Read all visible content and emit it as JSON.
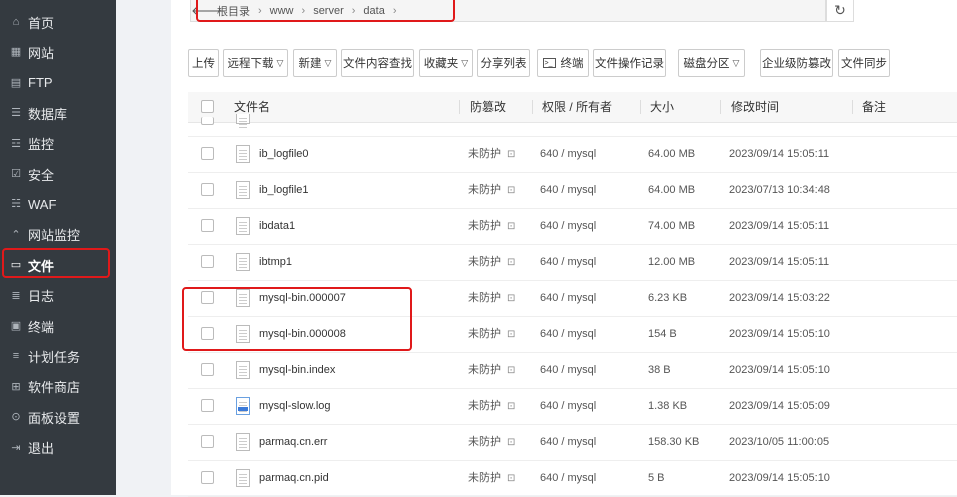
{
  "sidebar": {
    "items": [
      {
        "label": "首页",
        "icon": "home-icon",
        "glyph": "⌂"
      },
      {
        "label": "网站",
        "icon": "grid-icon",
        "glyph": "▦"
      },
      {
        "label": "FTP",
        "icon": "ftp-icon",
        "glyph": "▤"
      },
      {
        "label": "数据库",
        "icon": "database-icon",
        "glyph": "☰"
      },
      {
        "label": "监控",
        "icon": "monitor-icon",
        "glyph": "☲"
      },
      {
        "label": "安全",
        "icon": "shield-icon",
        "glyph": "☑"
      },
      {
        "label": "WAF",
        "icon": "waf-icon",
        "glyph": "☵"
      },
      {
        "label": "网站监控",
        "icon": "chart-icon",
        "glyph": "⌃"
      },
      {
        "label": "文件",
        "icon": "folder-icon",
        "glyph": "▭"
      },
      {
        "label": "日志",
        "icon": "log-icon",
        "glyph": "≣"
      },
      {
        "label": "终端",
        "icon": "terminal-icon",
        "glyph": "▣"
      },
      {
        "label": "计划任务",
        "icon": "task-icon",
        "glyph": "≡"
      },
      {
        "label": "软件商店",
        "icon": "store-icon",
        "glyph": "⊞"
      },
      {
        "label": "面板设置",
        "icon": "settings-icon",
        "glyph": "⊙"
      },
      {
        "label": "退出",
        "icon": "logout-icon",
        "glyph": "⇥"
      }
    ]
  },
  "path": {
    "back_icon": "arrow-left-icon",
    "crumbs": [
      "根目录",
      "www",
      "server",
      "data"
    ],
    "sep": "›",
    "refresh_icon": "refresh-icon"
  },
  "toolbar": {
    "upload": "上传",
    "remote_download": "远程下载",
    "new": "新建",
    "content_search": "文件内容查找",
    "favorites": "收藏夹",
    "share_list": "分享列表",
    "terminal": "终端",
    "file_ops_log": "文件操作记录",
    "disk_partition": "磁盘分区",
    "tamper_enterprise": "企业级防篡改",
    "file_sync": "文件同步"
  },
  "table": {
    "headers": {
      "name": "文件名",
      "tamper": "防篡改",
      "perm": "权限 / 所有者",
      "size": "大小",
      "mtime": "修改时间",
      "note": "备注"
    },
    "rows": [
      {
        "name": "ib_logfile0",
        "tamper": "未防护",
        "perm": "640 / mysql",
        "size": "64.00 MB",
        "mtime": "2023/09/14 15:05:11",
        "icon": "file"
      },
      {
        "name": "ib_logfile1",
        "tamper": "未防护",
        "perm": "640 / mysql",
        "size": "64.00 MB",
        "mtime": "2023/07/13 10:34:48",
        "icon": "file"
      },
      {
        "name": "ibdata1",
        "tamper": "未防护",
        "perm": "640 / mysql",
        "size": "74.00 MB",
        "mtime": "2023/09/14 15:05:11",
        "icon": "file"
      },
      {
        "name": "ibtmp1",
        "tamper": "未防护",
        "perm": "640 / mysql",
        "size": "12.00 MB",
        "mtime": "2023/09/14 15:05:11",
        "icon": "file"
      },
      {
        "name": "mysql-bin.000007",
        "tamper": "未防护",
        "perm": "640 / mysql",
        "size": "6.23 KB",
        "mtime": "2023/09/14 15:03:22",
        "icon": "file"
      },
      {
        "name": "mysql-bin.000008",
        "tamper": "未防护",
        "perm": "640 / mysql",
        "size": "154 B",
        "mtime": "2023/09/14 15:05:10",
        "icon": "file"
      },
      {
        "name": "mysql-bin.index",
        "tamper": "未防护",
        "perm": "640 / mysql",
        "size": "38 B",
        "mtime": "2023/09/14 15:05:10",
        "icon": "file"
      },
      {
        "name": "mysql-slow.log",
        "tamper": "未防护",
        "perm": "640 / mysql",
        "size": "1.38 KB",
        "mtime": "2023/09/14 15:05:09",
        "icon": "log"
      },
      {
        "name": "parmaq.cn.err",
        "tamper": "未防护",
        "perm": "640 / mysql",
        "size": "158.30 KB",
        "mtime": "2023/10/05 11:00:05",
        "icon": "file"
      },
      {
        "name": "parmaq.cn.pid",
        "tamper": "未防护",
        "perm": "640 / mysql",
        "size": "5 B",
        "mtime": "2023/09/14 15:05:10",
        "icon": "file"
      }
    ]
  },
  "colors": {
    "sidebar_bg": "#343a40",
    "highlight": "#e0191a"
  }
}
